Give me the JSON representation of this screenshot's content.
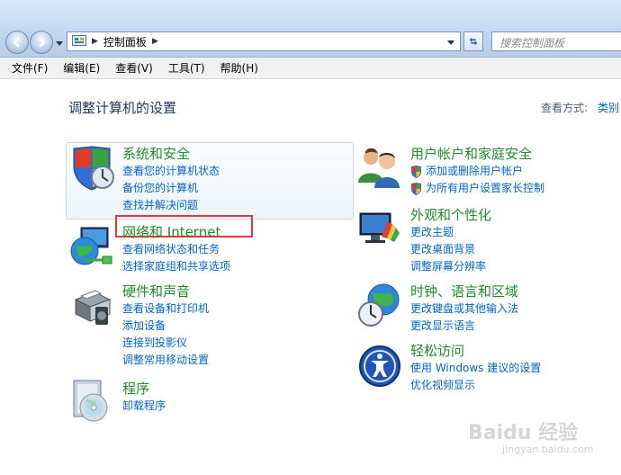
{
  "address": {
    "path": "控制面板",
    "search_placeholder": "搜索控制面板"
  },
  "menu": {
    "items": [
      "文件(F)",
      "编辑(E)",
      "查看(V)",
      "工具(T)",
      "帮助(H)"
    ]
  },
  "page": {
    "title": "调整计算机的设置",
    "view_label": "查看方式:",
    "view_value": "类别"
  },
  "categories": {
    "system_security": {
      "title": "系统和安全",
      "links": [
        "查看您的计算机状态",
        "备份您的计算机",
        "查找并解决问题"
      ]
    },
    "network": {
      "title": "网络和 Internet",
      "links": [
        "查看网络状态和任务",
        "选择家庭组和共享选项"
      ]
    },
    "hardware": {
      "title": "硬件和声音",
      "links": [
        "查看设备和打印机",
        "添加设备",
        "连接到投影仪",
        "调整常用移动设置"
      ]
    },
    "programs": {
      "title": "程序",
      "links": [
        "卸载程序"
      ]
    },
    "user_accounts": {
      "title": "用户帐户和家庭安全",
      "links": [
        "添加或删除用户帐户",
        "为所有用户设置家长控制"
      ]
    },
    "appearance": {
      "title": "外观和个性化",
      "links": [
        "更改主题",
        "更改桌面背景",
        "调整屏幕分辨率"
      ]
    },
    "clock": {
      "title": "时钟、语言和区域",
      "links": [
        "更改键盘或其他输入法",
        "更改显示语言"
      ]
    },
    "ease": {
      "title": "轻松访问",
      "links": [
        "使用 Windows 建议的设置",
        "优化视频显示"
      ]
    }
  },
  "watermark": {
    "text": "Baidu 经验",
    "sub": "jingyan.baidu.com"
  },
  "colors": {
    "category_title": "#1e8e2a",
    "link": "#0066cc",
    "highlight": "#e0393a"
  }
}
